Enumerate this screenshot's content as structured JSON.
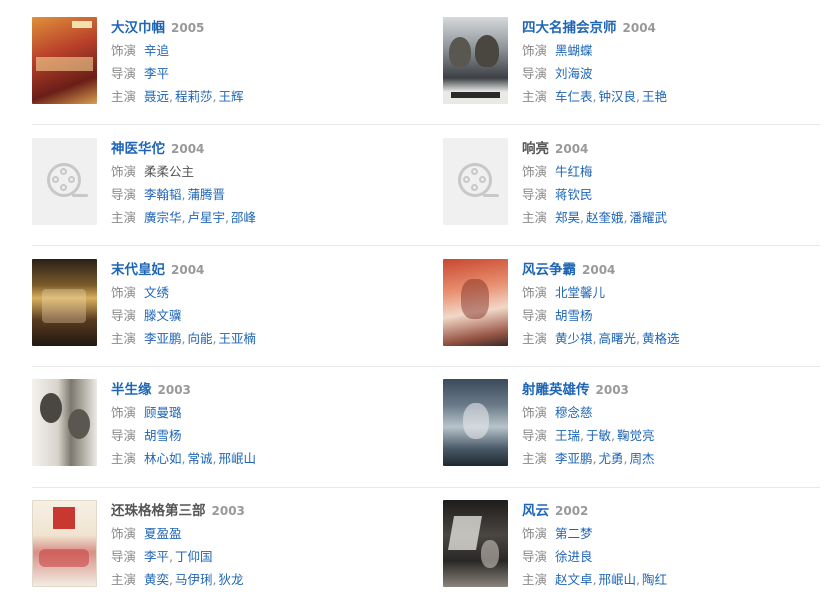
{
  "labels": {
    "role": "饰演",
    "director": "导演",
    "cast": "主演"
  },
  "movies": [
    {
      "title": "大汉巾帼",
      "year": "2005",
      "role": "辛追",
      "directors": [
        "李平"
      ],
      "cast": [
        "聂远",
        "程莉莎",
        "王辉"
      ]
    },
    {
      "title": "四大名捕会京师",
      "year": "2004",
      "role": "黑蝴蝶",
      "directors": [
        "刘海波"
      ],
      "cast": [
        "车仁表",
        "钟汉良",
        "王艳"
      ]
    },
    {
      "title": "神医华佗",
      "year": "2004",
      "role": "柔柔公主",
      "directors": [
        "李翰韬",
        "蒲腾晋"
      ],
      "cast": [
        "廣宗华",
        "卢星宇",
        "邵峰"
      ]
    },
    {
      "title": "响亮",
      "year": "2004",
      "role": "牛红梅",
      "directors": [
        "蒋钦民"
      ],
      "cast": [
        "郑昊",
        "赵奎娥",
        "潘耀武"
      ]
    },
    {
      "title": "末代皇妃",
      "year": "2004",
      "role": "文绣",
      "directors": [
        "滕文骥"
      ],
      "cast": [
        "李亚鹏",
        "向能",
        "王亚楠"
      ]
    },
    {
      "title": "风云争霸",
      "year": "2004",
      "role": "北堂馨儿",
      "directors": [
        "胡雪杨"
      ],
      "cast": [
        "黄少祺",
        "高曙光",
        "黄格选"
      ]
    },
    {
      "title": "半生缘",
      "year": "2003",
      "role": "顾曼璐",
      "directors": [
        "胡雪杨"
      ],
      "cast": [
        "林心如",
        "常诚",
        "邢岷山"
      ]
    },
    {
      "title": "射雕英雄传",
      "year": "2003",
      "role": "穆念慈",
      "directors": [
        "王瑞",
        "于敏",
        "鞠觉亮"
      ],
      "cast": [
        "李亚鹏",
        "尤勇",
        "周杰"
      ]
    },
    {
      "title": "还珠格格第三部",
      "year": "2003",
      "role": "夏盈盈",
      "directors": [
        "李平",
        "丁仰国"
      ],
      "cast": [
        "黄奕",
        "马伊琍",
        "狄龙"
      ]
    },
    {
      "title": "风云",
      "year": "2002",
      "role": "第二梦",
      "directors": [
        "徐进良"
      ],
      "cast": [
        "赵文卓",
        "邢岷山",
        "陶红"
      ]
    }
  ]
}
